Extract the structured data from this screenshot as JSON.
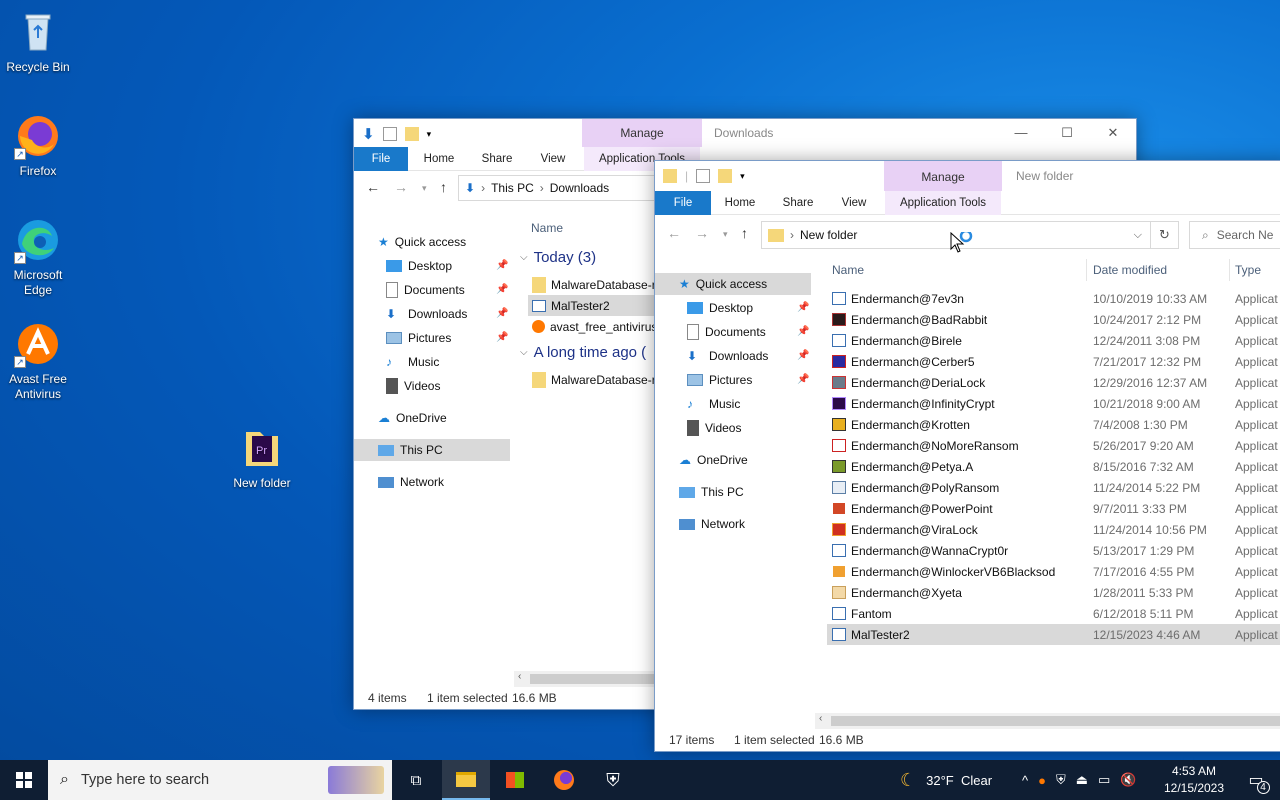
{
  "desktop": {
    "icons": [
      {
        "label": "Recycle Bin"
      },
      {
        "label": "Firefox"
      },
      {
        "label": "Microsoft Edge"
      },
      {
        "label": "Avast Free Antivirus"
      },
      {
        "label": "New folder"
      }
    ]
  },
  "window_back": {
    "title": "Downloads",
    "manage_label": "Manage",
    "ribbon_tabs": [
      "File",
      "Home",
      "Share",
      "View",
      "Application Tools"
    ],
    "breadcrumb": [
      "This PC",
      "Downloads"
    ],
    "column_name": "Name",
    "nav": {
      "quick_access": "Quick access",
      "items": [
        "Desktop",
        "Documents",
        "Downloads",
        "Pictures",
        "Music",
        "Videos"
      ],
      "onedrive": "OneDrive",
      "this_pc": "This PC",
      "network": "Network"
    },
    "groups": [
      {
        "title": "Today (3)",
        "files": [
          "MalwareDatabase-r",
          "MalTester2",
          "avast_free_antivirus"
        ]
      },
      {
        "title": "A long time ago (",
        "files": [
          "MalwareDatabase-r"
        ]
      }
    ],
    "status": {
      "items": "4 items",
      "selected": "1 item selected",
      "size": "16.6 MB"
    }
  },
  "window_front": {
    "title": "New folder",
    "manage_label": "Manage",
    "ribbon_tabs": [
      "File",
      "Home",
      "Share",
      "View",
      "Application Tools"
    ],
    "address": "New folder",
    "search_placeholder": "Search Ne",
    "columns": {
      "name": "Name",
      "date": "Date modified",
      "type": "Type"
    },
    "nav": {
      "quick_access": "Quick access",
      "items": [
        "Desktop",
        "Documents",
        "Downloads",
        "Pictures",
        "Music",
        "Videos"
      ],
      "onedrive": "OneDrive",
      "this_pc": "This PC",
      "network": "Network"
    },
    "files": [
      {
        "name": "Endermanch@7ev3n",
        "date": "10/10/2019 10:33 AM",
        "type": "Applicat",
        "icon": "exe-icon"
      },
      {
        "name": "Endermanch@BadRabbit",
        "date": "10/24/2017 2:12 PM",
        "type": "Applicat",
        "icon": "badrabbit-icon"
      },
      {
        "name": "Endermanch@Birele",
        "date": "12/24/2011 3:08 PM",
        "type": "Applicat",
        "icon": "exe-icon"
      },
      {
        "name": "Endermanch@Cerber5",
        "date": "7/21/2017 12:32 PM",
        "type": "Applicat",
        "icon": "cerber-icon"
      },
      {
        "name": "Endermanch@DeriaLock",
        "date": "12/29/2016 12:37 AM",
        "type": "Applicat",
        "icon": "derialock-icon"
      },
      {
        "name": "Endermanch@InfinityCrypt",
        "date": "10/21/2018 9:00 AM",
        "type": "Applicat",
        "icon": "premiere-icon"
      },
      {
        "name": "Endermanch@Krotten",
        "date": "7/4/2008 1:30 PM",
        "type": "Applicat",
        "icon": "krotten-icon"
      },
      {
        "name": "Endermanch@NoMoreRansom",
        "date": "5/26/2017 9:20 AM",
        "type": "Applicat",
        "icon": "nomoreransom-icon"
      },
      {
        "name": "Endermanch@Petya.A",
        "date": "8/15/2016 7:32 AM",
        "type": "Applicat",
        "icon": "petya-icon"
      },
      {
        "name": "Endermanch@PolyRansom",
        "date": "11/24/2014 5:22 PM",
        "type": "Applicat",
        "icon": "polyransom-icon"
      },
      {
        "name": "Endermanch@PowerPoint",
        "date": "9/7/2011 3:33 PM",
        "type": "Applicat",
        "icon": "powerpoint-icon"
      },
      {
        "name": "Endermanch@ViraLock",
        "date": "11/24/2014 10:56 PM",
        "type": "Applicat",
        "icon": "viralock-icon"
      },
      {
        "name": "Endermanch@WannaCrypt0r",
        "date": "5/13/2017 1:29 PM",
        "type": "Applicat",
        "icon": "exe-icon"
      },
      {
        "name": "Endermanch@WinlockerVB6Blacksod",
        "date": "7/17/2016 4:55 PM",
        "type": "Applicat",
        "icon": "winlocker-icon"
      },
      {
        "name": "Endermanch@Xyeta",
        "date": "1/28/2011 5:33 PM",
        "type": "Applicat",
        "icon": "xyeta-icon"
      },
      {
        "name": "Fantom",
        "date": "6/12/2018 5:11 PM",
        "type": "Applicat",
        "icon": "exe-icon"
      },
      {
        "name": "MalTester2",
        "date": "12/15/2023 4:46 AM",
        "type": "Applicat",
        "icon": "exe-icon"
      }
    ],
    "status": {
      "items": "17 items",
      "selected": "1 item selected",
      "size": "16.6 MB"
    }
  },
  "taskbar": {
    "search_placeholder": "Type here to search",
    "weather": "32°F  Clear",
    "time": "4:53 AM",
    "date": "12/15/2023",
    "notifications": "4"
  }
}
